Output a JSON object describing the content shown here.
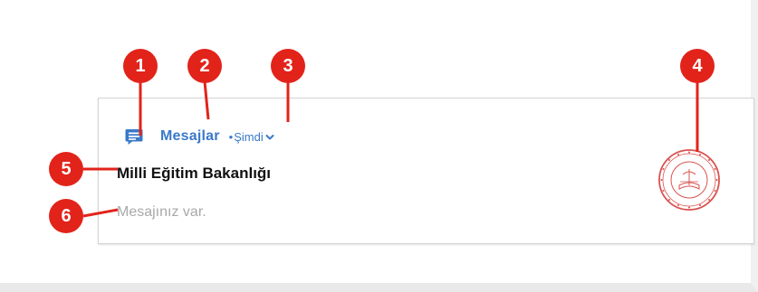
{
  "notification": {
    "app_icon": "message-icon",
    "app_name": "Mesajlar",
    "time_prefix": "•",
    "time": "Şimdi",
    "expand_icon": "chevron-down-icon",
    "sender": "Milli Eğitim Bakanlığı",
    "message": "Mesajınız var.",
    "sender_avatar": "ministry-seal"
  },
  "callouts": [
    {
      "label": "1"
    },
    {
      "label": "2"
    },
    {
      "label": "3"
    },
    {
      "label": "4"
    },
    {
      "label": "5"
    },
    {
      "label": "6"
    }
  ],
  "colors": {
    "accent": "#3a79c8",
    "callout": "#e2231a",
    "seal": "#d9534f",
    "secondary_text": "#a9a9a9"
  }
}
